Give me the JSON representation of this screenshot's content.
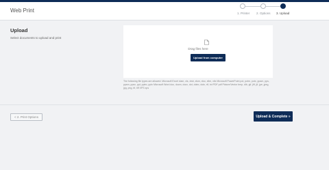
{
  "app": {
    "title": "Web Print"
  },
  "stepper": {
    "steps": [
      {
        "label": "1. Printer",
        "state": "done"
      },
      {
        "label": "2. Options",
        "state": "done"
      },
      {
        "label": "3. Upload",
        "state": "active"
      }
    ]
  },
  "upload_section": {
    "title": "Upload",
    "description": "Select documents to upload and print"
  },
  "dropzone": {
    "icon": "document-icon",
    "drag_text": "Drag files here",
    "button_label": "Upload from computer"
  },
  "file_types_note": "The following file types are allowed: Microsoft Excel xlam, xls, xlsb, xlsm, xlsx, xltm, xltx Microsoft PowerPoint pot, potm, potx, ppam, pps, ppsm, ppsx, ppt, pptm, pptx Microsoft Word doc, docm, docx, dot, dotm, dotx, rtf, txt PDF pdf Picture/Vector bmp, dib, gif, jfif, jif, jpe, jpeg, jpg, png, tif, tiff XPS xps",
  "footer": {
    "back_label": "< 2. Print Options",
    "next_label": "Upload & Complete »"
  },
  "colors": {
    "primary": "#0e2c57",
    "background": "#f1f2f4"
  }
}
